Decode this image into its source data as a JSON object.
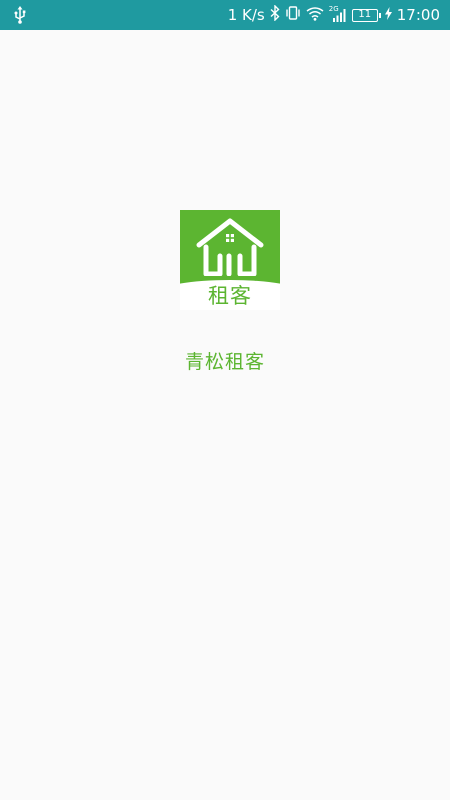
{
  "status_bar": {
    "left_icon": "usb-icon",
    "net_speed": "1 K/s",
    "icons": [
      "bluetooth-icon",
      "vibrate-icon",
      "wifi-icon",
      "signal-2g-icon"
    ],
    "network_label": "2G",
    "battery_level": "11",
    "charging_icon": "charging-bolt-icon",
    "time": "17:00"
  },
  "logo": {
    "icon": "house-icon",
    "text": "租客"
  },
  "app_name": "青松租客",
  "colors": {
    "status_bar": "#1f9aa0",
    "brand_green": "#5cb531",
    "background": "#fafafa"
  }
}
